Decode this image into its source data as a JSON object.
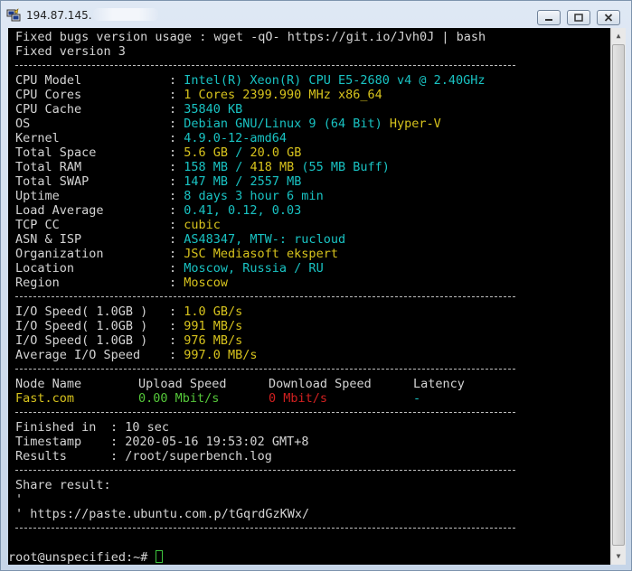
{
  "window": {
    "title": "194.87.145.",
    "colors": {
      "cyan": "#19c3c3",
      "yellow": "#d7c31d",
      "green": "#55c83a",
      "red": "#d22020",
      "text": "#d4d4d4"
    }
  },
  "header": {
    "line1": "Fixed bugs version usage : wget -qO- https://git.io/Jvh0J | bash",
    "line2": "Fixed version 3"
  },
  "sep": "----------------------------------------------------------------------",
  "sysinfo": {
    "cpu_model": {
      "label": "CPU Model",
      "value": "Intel(R) Xeon(R) CPU E5-2680 v4 @ 2.40GHz"
    },
    "cpu_cores": {
      "label": "CPU Cores",
      "value": "1 Cores 2399.990 MHz x86_64"
    },
    "cpu_cache": {
      "label": "CPU Cache",
      "value": "35840 KB"
    },
    "os": {
      "label": "OS",
      "value": "Debian GNU/Linux 9 (64 Bit)",
      "virt": "Hyper-V"
    },
    "kernel": {
      "label": "Kernel",
      "value": "4.9.0-12-amd64"
    },
    "total_space": {
      "label": "Total Space",
      "used": "5.6 GB",
      "total": "20.0 GB"
    },
    "total_ram": {
      "label": "Total RAM",
      "used": "158 MB",
      "total": "418 MB",
      "buff": "(55 MB Buff)"
    },
    "total_swap": {
      "label": "Total SWAP",
      "used": "147 MB",
      "total": "2557 MB"
    },
    "uptime": {
      "label": "Uptime",
      "value": "8 days 3 hour 6 min"
    },
    "load_average": {
      "label": "Load Average",
      "value": "0.41, 0.12, 0.03"
    },
    "tcp_cc": {
      "label": "TCP CC",
      "value": "cubic"
    },
    "asn_isp": {
      "label": "ASN & ISP",
      "value": "AS48347, MTW-: rucloud"
    },
    "organization": {
      "label": "Organization",
      "value": "JSC Mediasoft ekspert"
    },
    "location": {
      "label": "Location",
      "value": "Moscow, Russia / RU"
    },
    "region": {
      "label": "Region",
      "value": "Moscow"
    }
  },
  "io": {
    "runs": [
      {
        "label": "I/O Speed( 1.0GB )",
        "value": "1.0 GB/s"
      },
      {
        "label": "I/O Speed( 1.0GB )",
        "value": "991 MB/s"
      },
      {
        "label": "I/O Speed( 1.0GB )",
        "value": "976 MB/s"
      }
    ],
    "average": {
      "label": "Average I/O Speed",
      "value": "997.0 MB/s"
    }
  },
  "speedtest": {
    "headers": {
      "node": "Node Name",
      "upload": "Upload Speed",
      "download": "Download Speed",
      "latency": "Latency"
    },
    "rows": [
      {
        "node": "Fast.com",
        "upload": "0.00 Mbit/s",
        "download": "0 Mbit/s",
        "latency": "-"
      }
    ]
  },
  "summary": {
    "finished": {
      "label": "Finished in",
      "value": "10 sec"
    },
    "timestamp": {
      "label": "Timestamp",
      "value": "2020-05-16 19:53:02 GMT+8"
    },
    "results": {
      "label": "Results",
      "value": "/root/superbench.log"
    }
  },
  "share": {
    "heading": "Share result:",
    "tick1": "'",
    "tick2": "'",
    "url": "https://paste.ubuntu.com.p/tGqrdGzKWx/"
  },
  "prompt": {
    "text": "root@unspecified:~# "
  }
}
